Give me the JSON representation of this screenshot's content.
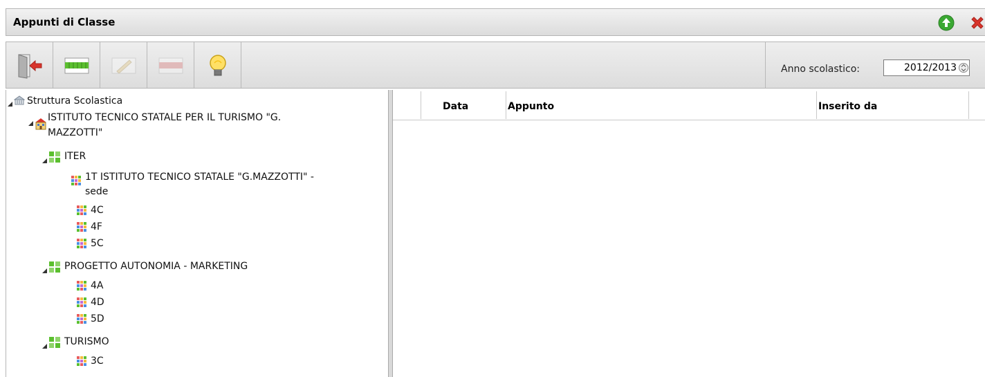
{
  "window": {
    "title": "Appunti di Classe"
  },
  "toolbar": {
    "buttons": [
      "exit-icon",
      "grid-view-icon",
      "edit-icon",
      "remove-icon",
      "lightbulb-icon"
    ],
    "year_label": "Anno scolastico:",
    "year_value": "2012/2013"
  },
  "tree": {
    "root": "Struttura Scolastica",
    "institute_line1": "ISTITUTO TECNICO STATALE PER IL TURISMO \"G.",
    "institute_line2": "MAZZOTTI\"",
    "iter": {
      "label": "ITER",
      "class_1t_line1": "1T ISTITUTO TECNICO STATALE \"G.MAZZOTTI\" -",
      "class_1t_line2": "sede",
      "classes": [
        "4C",
        "4F",
        "5C"
      ]
    },
    "marketing": {
      "label": "PROGETTO AUTONOMIA - MARKETING",
      "classes": [
        "4A",
        "4D",
        "5D"
      ]
    },
    "turismo": {
      "label": "TURISMO",
      "classes": [
        "3C"
      ]
    }
  },
  "grid": {
    "columns": {
      "data": "Data",
      "appunto": "Appunto",
      "inserito": "Inserito da"
    }
  },
  "colors": {
    "accent_green": "#3aa832",
    "close_red": "#d9342b"
  }
}
